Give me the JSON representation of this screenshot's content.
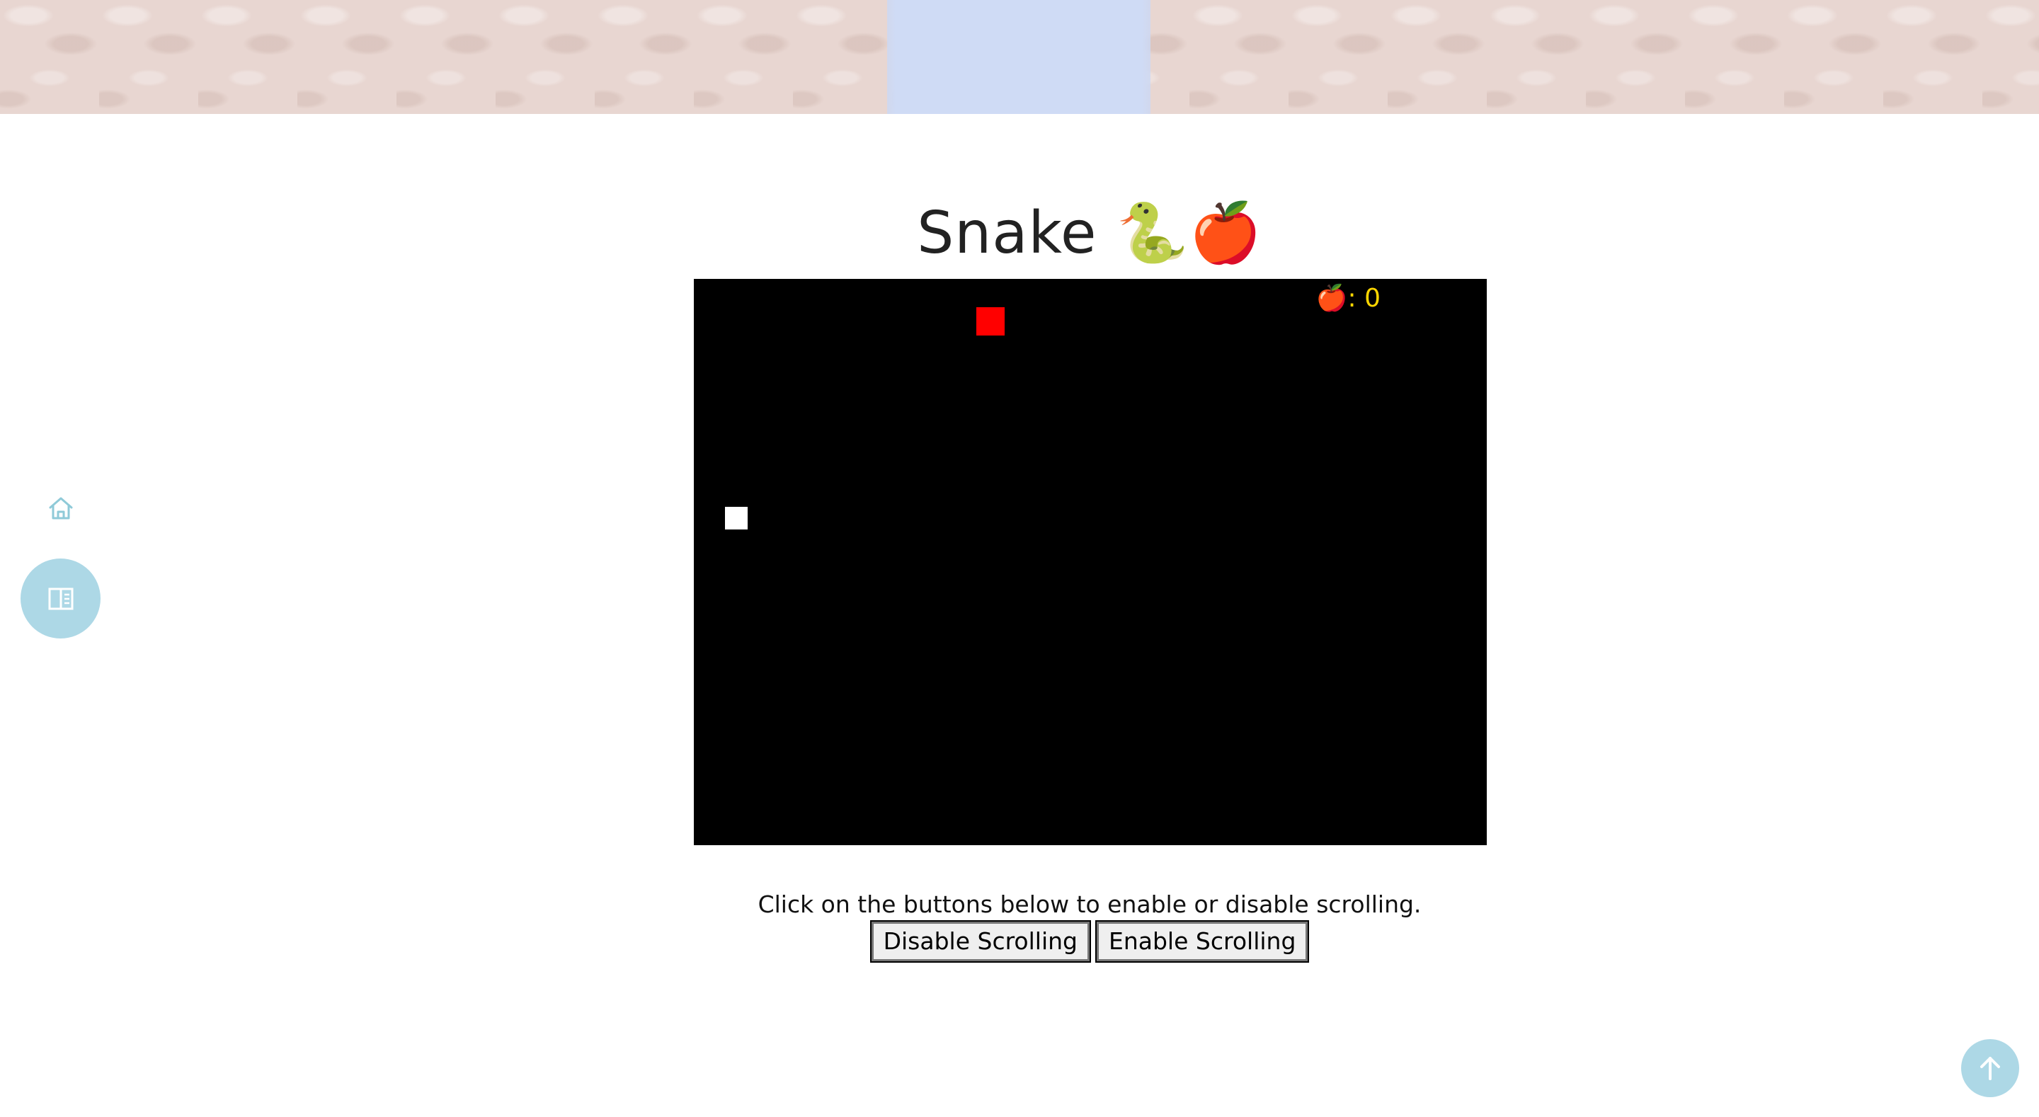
{
  "page": {
    "title": "Snake 🐍🍎"
  },
  "game": {
    "score_label": "🍎: 0",
    "score": 0,
    "colors": {
      "board": "#000000",
      "food": "#ff0000",
      "snake": "#ffffff",
      "score_text": "#ffd700"
    }
  },
  "controls": {
    "instructions": "Click on the buttons below to enable or disable scrolling.",
    "disable_label": "Disable Scrolling",
    "enable_label": "Enable Scrolling"
  },
  "nav": {
    "home_icon": "home-icon",
    "toc_icon": "book-open-icon",
    "back_to_top_icon": "arrow-up-icon",
    "accent": "#add8e6"
  },
  "banner": {
    "base_color": "#e8d6d1",
    "center_color": "#cfdbf5"
  }
}
